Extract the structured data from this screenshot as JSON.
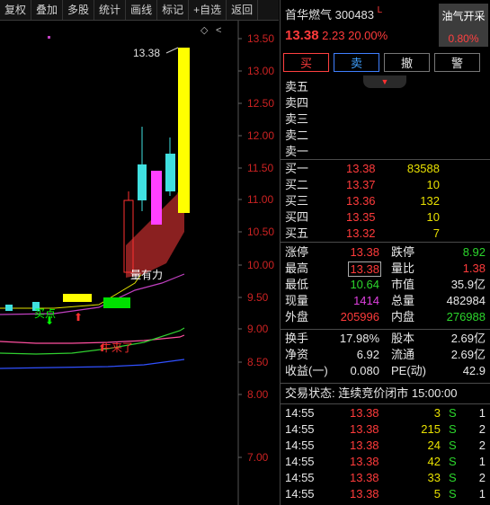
{
  "toolbar": [
    "复权",
    "叠加",
    "多股",
    "统计",
    "画线",
    "标记",
    "+自选",
    "返回"
  ],
  "chart": {
    "y_labels": [
      "13.50",
      "13.00",
      "12.50",
      "12.00",
      "11.50",
      "11.00",
      "10.50",
      "10.00",
      "9.50",
      "9.00",
      "8.50",
      "8.00",
      "7.00"
    ],
    "high_label": "13.38",
    "ann_qianliang": "量有力",
    "ann_maidian": "买点",
    "ann_niu": "牛来了",
    "colors": {
      "up": "#ff2020",
      "down": "#40e0e0",
      "limit": "#ffff00",
      "signal": "#00ff00"
    }
  },
  "stock": {
    "name": "首华燃气",
    "code": "300483",
    "flag": "L",
    "price": "13.38",
    "change": "2.23",
    "pct": "20.00%"
  },
  "sector": {
    "name": "油气开采",
    "pct": "0.80%"
  },
  "actions": [
    "买",
    "卖",
    "撤",
    "警"
  ],
  "sell": [
    "卖五",
    "卖四",
    "卖三",
    "卖二",
    "卖一"
  ],
  "buy": [
    {
      "label": "买一",
      "price": "13.38",
      "vol": "83588"
    },
    {
      "label": "买二",
      "price": "13.37",
      "vol": "10"
    },
    {
      "label": "买三",
      "price": "13.36",
      "vol": "132"
    },
    {
      "label": "买四",
      "price": "13.35",
      "vol": "10"
    },
    {
      "label": "买五",
      "price": "13.32",
      "vol": "7"
    }
  ],
  "stats": [
    {
      "l1": "涨停",
      "v1": "13.38",
      "l2": "跌停",
      "v2": "8.92"
    },
    {
      "l1": "最高",
      "v1": "13.38",
      "l2": "量比",
      "v2": "1.38"
    },
    {
      "l1": "最低",
      "v1": "10.64",
      "l2": "市值",
      "v2": "35.9亿"
    },
    {
      "l1": "现量",
      "v1": "1414",
      "l2": "总量",
      "v2": "482984"
    },
    {
      "l1": "外盘",
      "v1": "205996",
      "l2": "内盘",
      "v2": "276988"
    }
  ],
  "stats2": [
    {
      "l1": "换手",
      "v1": "17.98%",
      "l2": "股本",
      "v2": "2.69亿"
    },
    {
      "l1": "净资",
      "v1": "6.92",
      "l2": "流通",
      "v2": "2.69亿"
    },
    {
      "l1": "收益(一)",
      "v1": "0.080",
      "l2": "PE(动)",
      "v2": "42.9"
    }
  ],
  "status": "交易状态: 连续竞价闭市 15:00:00",
  "trades": [
    {
      "t": "14:55",
      "p": "13.38",
      "v": "3",
      "s": "S",
      "n": "1"
    },
    {
      "t": "14:55",
      "p": "13.38",
      "v": "215",
      "s": "S",
      "n": "2"
    },
    {
      "t": "14:55",
      "p": "13.38",
      "v": "24",
      "s": "S",
      "n": "2"
    },
    {
      "t": "14:55",
      "p": "13.38",
      "v": "42",
      "s": "S",
      "n": "1"
    },
    {
      "t": "14:55",
      "p": "13.38",
      "v": "33",
      "s": "S",
      "n": "2"
    },
    {
      "t": "14:55",
      "p": "13.38",
      "v": "5",
      "s": "S",
      "n": "1"
    }
  ]
}
